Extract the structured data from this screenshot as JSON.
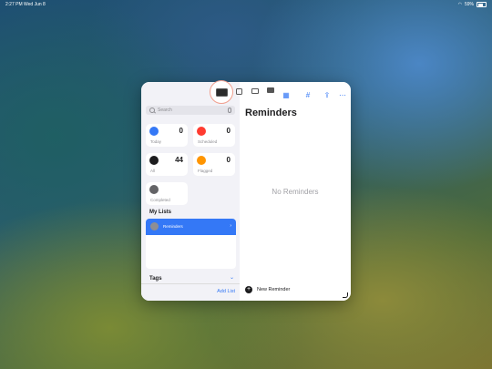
{
  "status_bar": {
    "time_date": "2:27 PM   Wed Jun 8",
    "battery": "59%"
  },
  "sidebar": {
    "search_placeholder": "Search",
    "smart_lists": [
      {
        "label": "Today",
        "count": "0",
        "color": "#3478f6",
        "icon": "calendar-icon"
      },
      {
        "label": "Scheduled",
        "count": "0",
        "color": "#ff3b30",
        "icon": "calendar-clock-icon"
      },
      {
        "label": "All",
        "count": "44",
        "color": "#1c1c1e",
        "icon": "tray-icon"
      },
      {
        "label": "Flagged",
        "count": "0",
        "color": "#ff9500",
        "icon": "flag-icon"
      },
      {
        "label": "Completed",
        "count": "",
        "color": "#636366",
        "icon": "checkmark-icon"
      }
    ],
    "my_lists_title": "My Lists",
    "lists": [
      {
        "name": "Reminders",
        "chevron": "›"
      }
    ],
    "tags_title": "Tags",
    "add_list_label": "Add List"
  },
  "main": {
    "title": "Reminders",
    "empty_message": "No Reminders",
    "new_reminder_label": "New Reminder"
  },
  "multitask_menu": {
    "options": [
      "full-screen-icon",
      "split-view-icon",
      "slide-over-icon",
      "stage-manager-icon"
    ]
  },
  "colors": {
    "accent": "#3478f6"
  }
}
